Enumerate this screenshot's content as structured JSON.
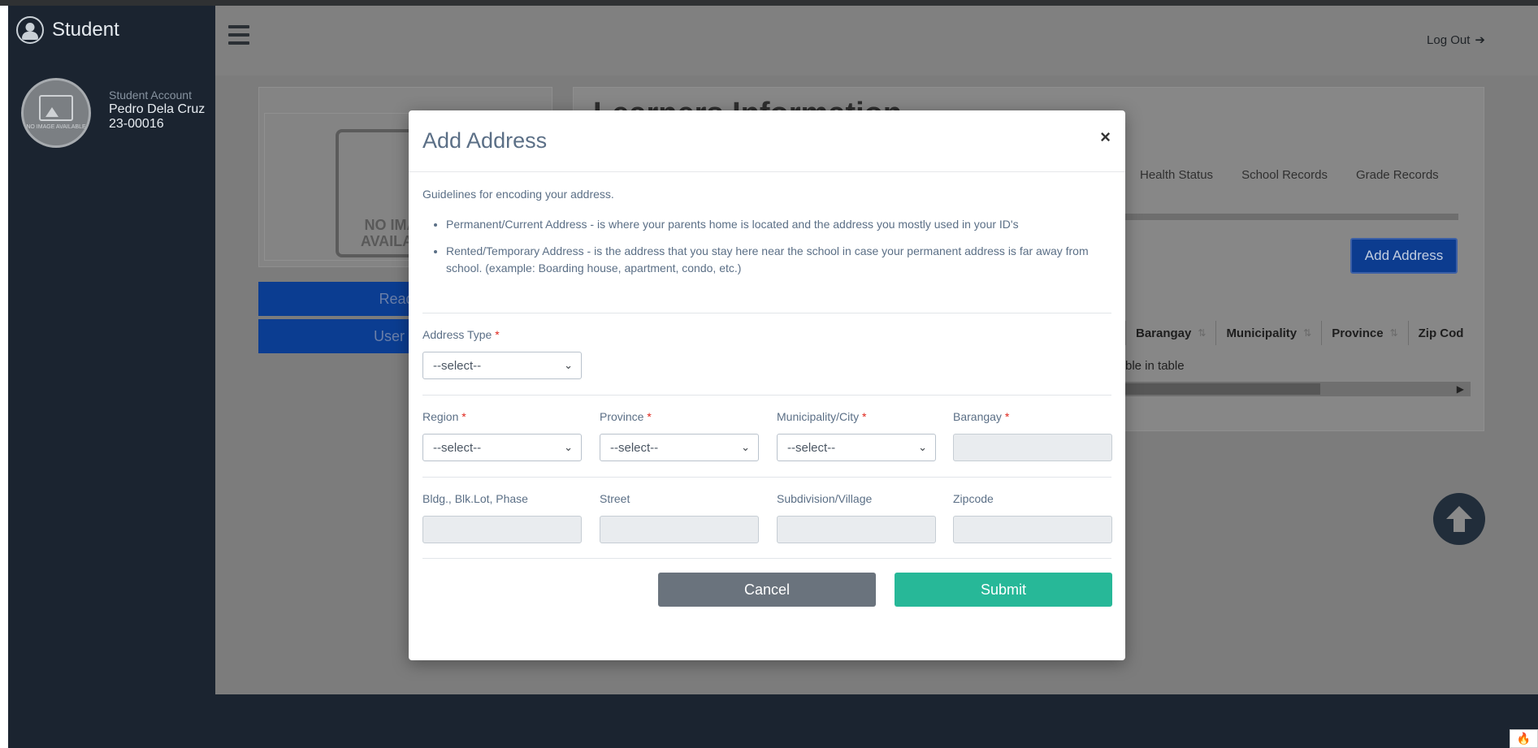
{
  "sidebar": {
    "brand": "Student",
    "avatar_text": "NO IMAGE AVAILABLE",
    "account_label": "Student Account",
    "student_name": "Pedro Dela Cruz",
    "student_id": "23-00016"
  },
  "header": {
    "logout_label": "Log Out"
  },
  "background": {
    "no_image_text": "NO IMAGE AVAILABLE",
    "page_title": "Learners Information",
    "buttons": [
      "Read",
      "User C"
    ],
    "tabs": [
      "Health Status",
      "School Records",
      "Grade Records"
    ],
    "add_address_label": "Add Address",
    "table_columns": [
      "Barangay",
      "Municipality",
      "Province",
      "Zip Cod"
    ],
    "empty_text": "ble in table"
  },
  "modal": {
    "title": "Add Address",
    "close_symbol": "×",
    "guidelines_intro": "Guidelines for encoding your address.",
    "guidelines": [
      "Permanent/Current Address - is where your parents home is located and the address you mostly used in your ID's",
      "Rented/Temporary Address - is the address that you stay here near the school in case your permanent address is far away from school. (example: Boarding house, apartment, condo, etc.)"
    ],
    "address_type_label": "Address Type",
    "select_placeholder": "--select--",
    "region_label": "Region",
    "province_label": "Province",
    "municipality_label": "Municipality/City",
    "barangay_label": "Barangay",
    "bldg_label": "Bldg., Blk.Lot, Phase",
    "street_label": "Street",
    "subdivision_label": "Subdivision/Village",
    "zipcode_label": "Zipcode",
    "required_mark": "*",
    "cancel_label": "Cancel",
    "submit_label": "Submit"
  }
}
